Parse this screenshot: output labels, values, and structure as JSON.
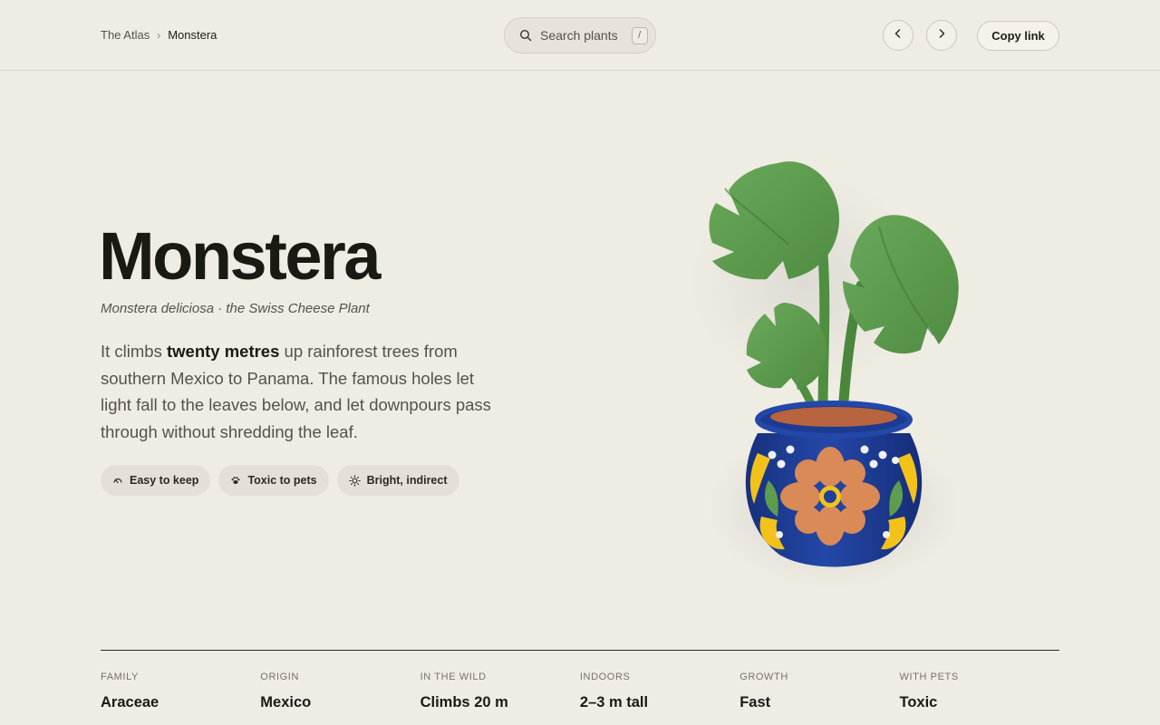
{
  "header": {
    "breadcrumb_root": "The Atlas",
    "breadcrumb_sep": "›",
    "breadcrumb_current": "Monstera",
    "search_placeholder": "Search plants",
    "search_shortcut": "/",
    "copy_link_label": "Copy link",
    "prev_icon": "chevron-left-icon",
    "next_icon": "chevron-right-icon"
  },
  "hero": {
    "title": "Monstera",
    "subtitle": "Monstera deliciosa · the Swiss Cheese Plant",
    "description_pre": "It climbs ",
    "description_bold": "twenty metres",
    "description_post": " up rainforest trees from southern Mexico to Panama. The famous holes let light fall to the leaves below, and let downpours pass through without shredding the leaf.",
    "tags": [
      {
        "label": "Easy to keep",
        "icon": "gauge-icon"
      },
      {
        "label": "Toxic to pets",
        "icon": "paw-icon"
      },
      {
        "label": "Bright, indirect",
        "icon": "sun-icon"
      }
    ]
  },
  "stats": [
    {
      "label": "Family",
      "value": "Araceae"
    },
    {
      "label": "Origin",
      "value": "Mexico"
    },
    {
      "label": "In the wild",
      "value": "Climbs 20 m"
    },
    {
      "label": "Indoors",
      "value": "2–3 m tall"
    },
    {
      "label": "Growth",
      "value": "Fast"
    },
    {
      "label": "With pets",
      "value": "Toxic"
    }
  ],
  "colors": {
    "background": "#efece4",
    "leaf": "#5e9d4f",
    "pot": "#1f3f9a",
    "flower": "#d98a56",
    "accent_yellow": "#f2c21b"
  }
}
